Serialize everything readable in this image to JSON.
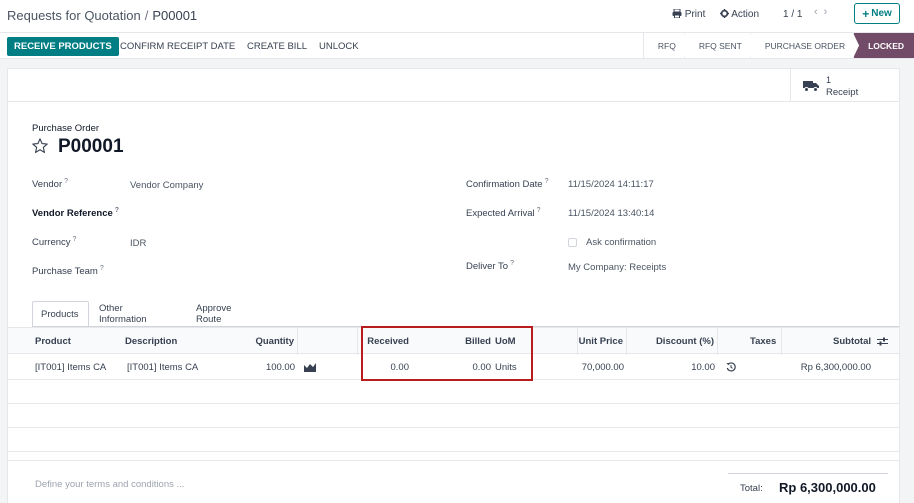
{
  "breadcrumb": {
    "parent": "Requests for Quotation",
    "separator": "/",
    "current": "P00001"
  },
  "header": {
    "print_label": "Print",
    "action_label": "Action",
    "pager": "1 / 1",
    "new_label": "New"
  },
  "actions": {
    "receive_products": "RECEIVE PRODUCTS",
    "confirm_receipt_date": "CONFIRM RECEIPT DATE",
    "create_bill": "CREATE BILL",
    "unlock": "UNLOCK"
  },
  "statusbar": {
    "stages": [
      "RFQ",
      "RFQ SENT",
      "PURCHASE ORDER",
      "LOCKED"
    ],
    "active": "LOCKED"
  },
  "smart_buttons": {
    "receipt_count": "1",
    "receipt_label": "Receipt"
  },
  "form": {
    "type_label": "Purchase Order",
    "number": "P00001",
    "vendor_label": "Vendor",
    "vendor_value": "Vendor Company",
    "vendor_ref_label": "Vendor Reference",
    "currency_label": "Currency",
    "currency_value": "IDR",
    "purchase_team_label": "Purchase Team",
    "confirmation_date_label": "Confirmation Date",
    "confirmation_date_value": "11/15/2024 14:11:17",
    "expected_arrival_label": "Expected Arrival",
    "expected_arrival_value": "11/15/2024 13:40:14",
    "ask_confirmation_label": "Ask confirmation",
    "deliver_to_label": "Deliver To",
    "deliver_to_value": "My Company: Receipts",
    "help_mark": "?"
  },
  "tabs": [
    "Products",
    "Other Information",
    "Approve Route"
  ],
  "table": {
    "columns": {
      "product": "Product",
      "description": "Description",
      "quantity": "Quantity",
      "received": "Received",
      "billed": "Billed",
      "uom": "UoM",
      "unit_price": "Unit Price",
      "discount": "Discount (%)",
      "taxes": "Taxes",
      "subtotal": "Subtotal"
    },
    "rows": [
      {
        "product": "[IT001] Items CA",
        "description": "[IT001] Items CA",
        "quantity": "100.00",
        "received": "0.00",
        "billed": "0.00",
        "uom": "Units",
        "unit_price": "70,000.00",
        "discount": "10.00",
        "taxes": "",
        "subtotal": "Rp 6,300,000.00"
      }
    ]
  },
  "footer": {
    "terms_placeholder": "Define your terms and conditions ...",
    "total_label": "Total:",
    "total_value": "Rp 6,300,000.00"
  },
  "colors": {
    "primary": "#017e84",
    "active_stage": "#714b67",
    "highlight": "#b91c1c"
  }
}
